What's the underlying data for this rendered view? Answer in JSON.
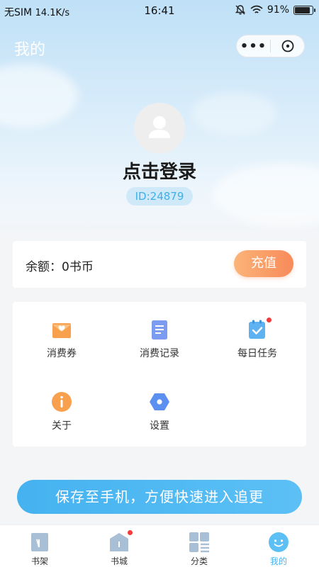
{
  "status_bar": {
    "carrier": "无SIM",
    "speed": "14.1K/s",
    "time": "16:41",
    "battery": "91%"
  },
  "header": {
    "title": "我的",
    "more_label": "•••"
  },
  "profile": {
    "login_label": "点击登录",
    "user_id": "ID:24879"
  },
  "balance": {
    "text": "余额：0书币",
    "recharge_label": "充值"
  },
  "grid": {
    "items": [
      {
        "label": "消费券",
        "icon": "voucher-icon"
      },
      {
        "label": "消费记录",
        "icon": "document-icon"
      },
      {
        "label": "每日任务",
        "icon": "clipboard-check-icon"
      },
      {
        "label": "关于",
        "icon": "info-icon"
      },
      {
        "label": "设置",
        "icon": "settings-icon"
      }
    ]
  },
  "save_banner": {
    "label": "保存至手机，方便快速进入追更"
  },
  "tabbar": {
    "items": [
      {
        "label": "书架",
        "icon": "bookshelf-icon"
      },
      {
        "label": "书城",
        "icon": "bookstore-icon"
      },
      {
        "label": "分类",
        "icon": "category-icon"
      },
      {
        "label": "我的",
        "icon": "profile-face-icon"
      }
    ],
    "active_index": 3
  },
  "colors": {
    "accent": "#45b2f0",
    "recharge_start": "#fbb478",
    "recharge_end": "#f88a5a",
    "badge_red": "#f23c3c"
  }
}
